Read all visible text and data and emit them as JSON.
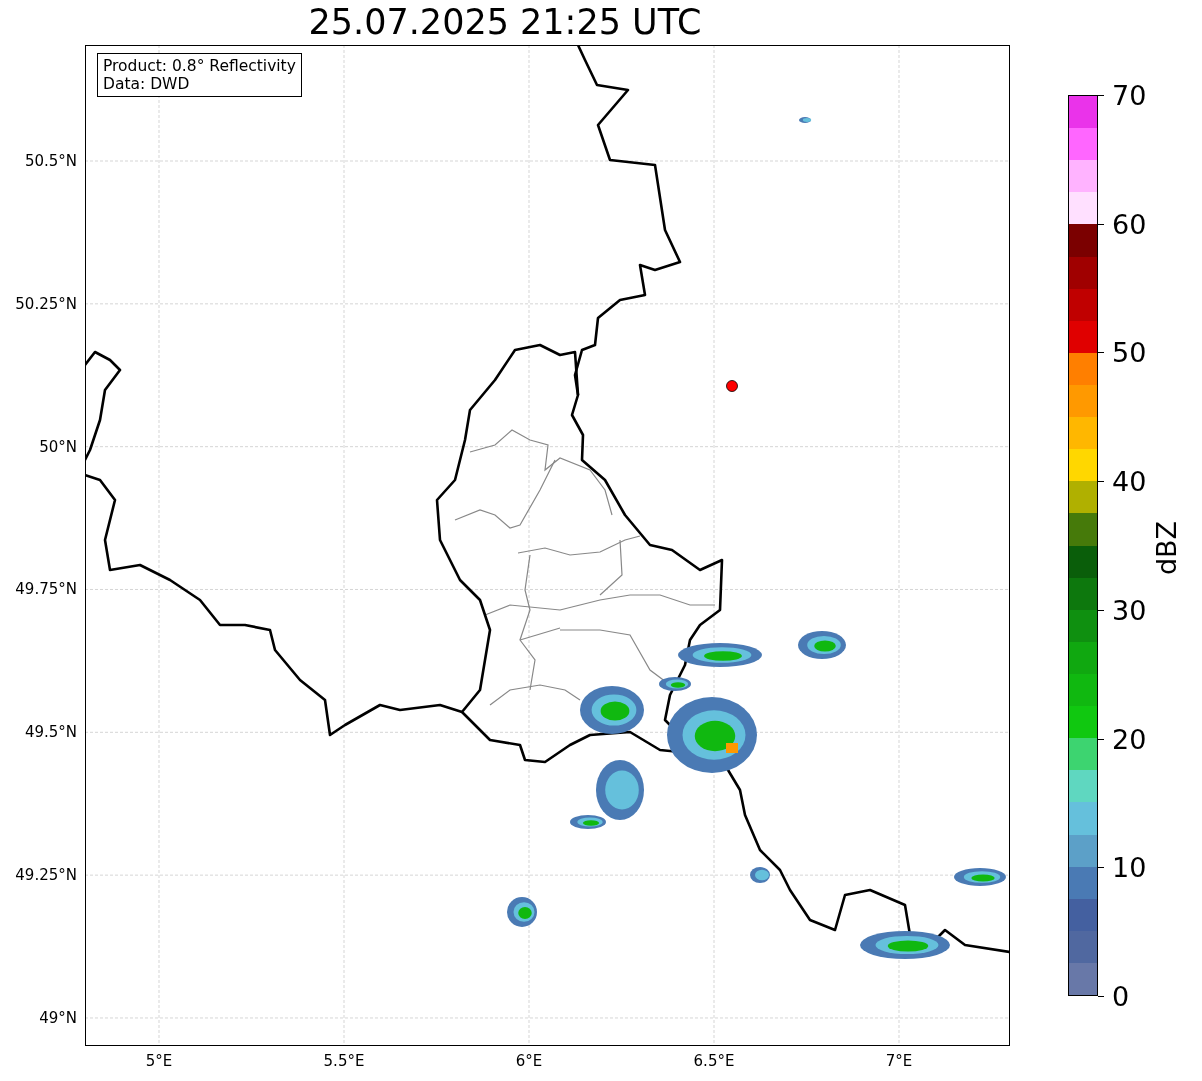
{
  "title": "25.07.2025 21:25 UTC",
  "info_box": [
    "Product: 0.8° Reflectivity",
    "Data: DWD"
  ],
  "map": {
    "lat_ticks": [
      "50.5°N",
      "50.25°N",
      "50°N",
      "49.75°N",
      "49.5°N",
      "49.25°N",
      "49°N"
    ],
    "lon_ticks": [
      "5°E",
      "5.5°E",
      "6°E",
      "6.5°E",
      "7°E"
    ]
  },
  "colorbar": {
    "label": "dBZ",
    "ticks": [
      "70",
      "60",
      "50",
      "40",
      "30",
      "20",
      "10",
      "0"
    ],
    "bins": [
      {
        "color": "#ea33ea"
      },
      {
        "color": "#ff66ff"
      },
      {
        "color": "#ffb3ff"
      },
      {
        "color": "#ffe0ff"
      },
      {
        "color": "#7b0000"
      },
      {
        "color": "#a00000"
      },
      {
        "color": "#c00000"
      },
      {
        "color": "#e00000"
      },
      {
        "color": "#ff7f00"
      },
      {
        "color": "#ff9900"
      },
      {
        "color": "#ffb700"
      },
      {
        "color": "#ffd700"
      },
      {
        "color": "#b0b000"
      },
      {
        "color": "#467a0a"
      },
      {
        "color": "#0a5e0a"
      },
      {
        "color": "#0d780d"
      },
      {
        "color": "#0f9010"
      },
      {
        "color": "#10a810"
      },
      {
        "color": "#10b810"
      },
      {
        "color": "#10c810"
      },
      {
        "color": "#3dd470"
      },
      {
        "color": "#5fd7c0"
      },
      {
        "color": "#65c0dc"
      },
      {
        "color": "#5ca0c8"
      },
      {
        "color": "#4a7ab4"
      },
      {
        "color": "#4460a0"
      },
      {
        "color": "#5068a0"
      },
      {
        "color": "#6878a8"
      }
    ]
  }
}
